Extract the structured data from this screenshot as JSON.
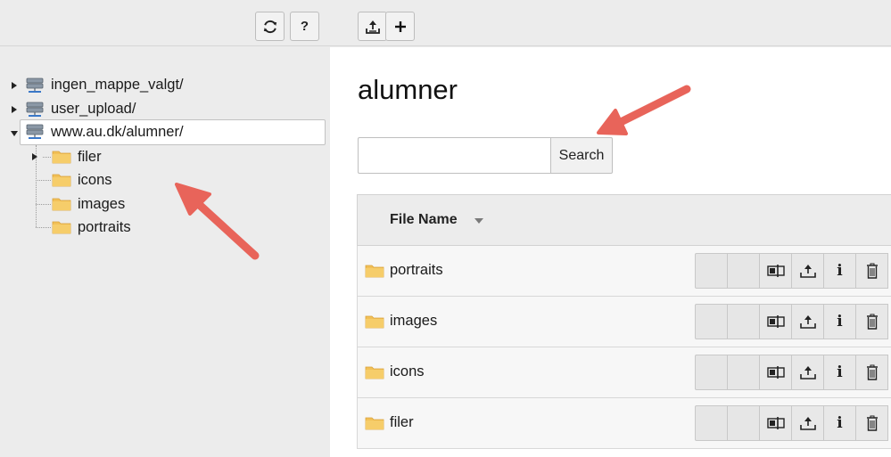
{
  "toolbar": {
    "refresh_icon": "refresh-icon",
    "help_label": "?",
    "upload_icon": "upload-icon",
    "add_label": "+"
  },
  "tree": {
    "roots": [
      {
        "label": "ingen_mappe_valgt/",
        "expanded": false,
        "icon": "storage-icon"
      },
      {
        "label": "user_upload/",
        "expanded": false,
        "icon": "storage-icon"
      },
      {
        "label": "www.au.dk/alumner/",
        "expanded": true,
        "selected": true,
        "icon": "storage-icon"
      }
    ],
    "children": [
      {
        "label": "filer",
        "has_children": true,
        "icon": "folder-icon"
      },
      {
        "label": "icons",
        "has_children": false,
        "icon": "folder-icon"
      },
      {
        "label": "images",
        "has_children": false,
        "icon": "folder-icon"
      },
      {
        "label": "portraits",
        "has_children": false,
        "icon": "folder-icon"
      }
    ]
  },
  "main": {
    "title": "alumner",
    "search": {
      "value": "",
      "placeholder": "",
      "button_label": "Search"
    },
    "table": {
      "column_header": "File Name",
      "rows": [
        {
          "name": "portraits",
          "icon": "folder-icon"
        },
        {
          "name": "images",
          "icon": "folder-icon"
        },
        {
          "name": "icons",
          "icon": "folder-icon"
        },
        {
          "name": "filer",
          "icon": "folder-icon"
        }
      ],
      "action_icons": [
        "blank",
        "blank",
        "rename-icon",
        "upload-icon",
        "info-icon",
        "trash-icon"
      ],
      "info_glyph": "i"
    }
  },
  "colors": {
    "annotation_arrow": "#e8645a",
    "folder": "#f2c057",
    "panel_bg": "#ececec",
    "main_bg": "#ffffff"
  }
}
